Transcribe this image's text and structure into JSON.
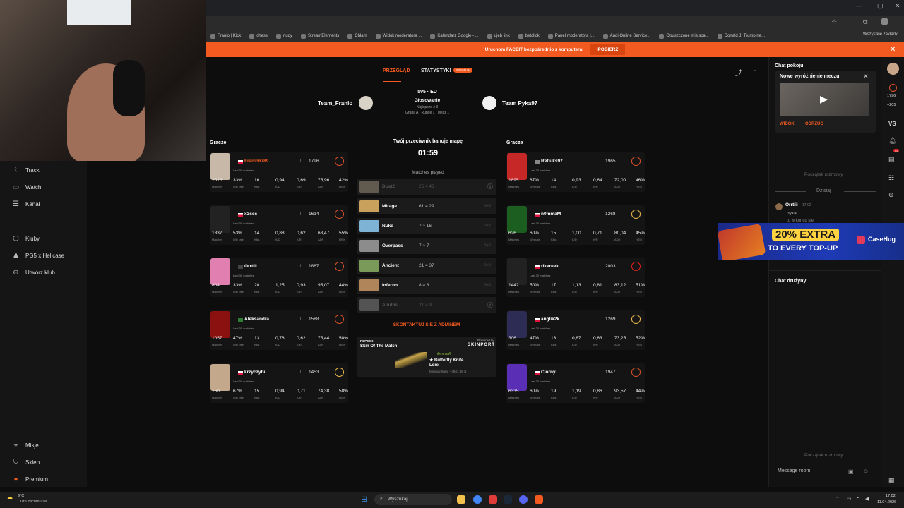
{
  "browser": {
    "bookmarks": [
      "Franio | Kick",
      "chess",
      "nudy",
      "StreamElements",
      "Chłam",
      "Widok moderatora ...",
      "Kalendarz Google - ...",
      "ujeb link",
      "betclick",
      "Panel moderatora |...",
      "Audi Online Service...",
      "Opuszczone miejsca...",
      "Donald J. Trump ne..."
    ],
    "all_bookmarks": "Wszystkie zakładki"
  },
  "sidebar": {
    "items": [
      {
        "label": "Track",
        "icon": "chart-icon"
      },
      {
        "label": "Watch",
        "icon": "video-icon"
      },
      {
        "label": "Kanał",
        "icon": "list-icon"
      },
      {
        "label": "Kluby",
        "icon": "shield-icon"
      },
      {
        "label": "PG5 x Hellcase",
        "icon": "club-icon"
      },
      {
        "label": "Utwórz klub",
        "icon": "plus-icon"
      },
      {
        "label": "Misje",
        "icon": "mission-icon"
      },
      {
        "label": "Sklep",
        "icon": "cart-icon"
      },
      {
        "label": "Premium",
        "icon": "premium-icon"
      }
    ]
  },
  "banner": {
    "text": "Uruchom FACEIT bezpośrednio z komputera!",
    "button": "POBIERZ",
    "close": "✕"
  },
  "match": {
    "tabs": {
      "overview": "PRZEGLĄD",
      "stats": "STATYSTYKI",
      "stats_badge": "PREMIUM"
    },
    "mode": "5v5 · EU",
    "status": "Głosowanie",
    "best_of": "Najlepsze z 3",
    "group": "Grupa A · Runde 1 · Mecz 1",
    "team1": "Team_Franio",
    "team2": "Team Pyka97",
    "players_label": "Gracze",
    "veto_title": "Twój przeciwnik banuje mapę",
    "timer": "01:59",
    "matches_played": "Matches played",
    "contact_admin": "SKONTAKTUJ SIĘ Z ADMINEM",
    "stat_labels": [
      "Matches",
      "Win rate",
      "Kills",
      "K/D",
      "K/R",
      "ADR",
      "HS%"
    ],
    "last30": "Last 30 matches"
  },
  "team1_players": [
    {
      "name": "Franio6789",
      "elo": "1796",
      "stats": [
        "2015",
        "33%",
        "16",
        "0,94",
        "0,69",
        "75,96",
        "42%"
      ],
      "name_color": "#f25a1f"
    },
    {
      "name": "x3scc",
      "elo": "1614",
      "stats": [
        "1837",
        "53%",
        "14",
        "0,88",
        "0,62",
        "68,47",
        "55%"
      ],
      "name_color": "#ffffff"
    },
    {
      "name": "Orrtiii",
      "elo": "1867",
      "stats": [
        "804",
        "33%",
        "20",
        "1,25",
        "0,93",
        "95,07",
        "44%"
      ],
      "name_color": "#ffffff"
    },
    {
      "name": "Aleksandra",
      "elo": "1588",
      "stats": [
        "1057",
        "47%",
        "13",
        "0,76",
        "0,62",
        "75,44",
        "58%"
      ],
      "name_color": "#ffffff"
    },
    {
      "name": "krzyczybu",
      "elo": "1453",
      "stats": [
        "160",
        "67%",
        "15",
        "0,94",
        "0,71",
        "74,38",
        "58%"
      ],
      "name_color": "#ffffff"
    }
  ],
  "team2_players": [
    {
      "name": "Refluks97",
      "elo": "1965",
      "stats": [
        "1895",
        "67%",
        "14",
        "0,93",
        "0,64",
        "72,00",
        "46%"
      ],
      "name_color": "#ffffff"
    },
    {
      "name": "n0mmaM",
      "elo": "1268",
      "stats": [
        "626",
        "60%",
        "15",
        "1,00",
        "0,71",
        "80,04",
        "45%"
      ],
      "name_color": "#ffffff"
    },
    {
      "name": "rikereek",
      "elo": "2003",
      "stats": [
        "1442",
        "50%",
        "17",
        "1,13",
        "0,81",
        "83,12",
        "51%"
      ],
      "name_color": "#ffffff"
    },
    {
      "name": "anglik2k",
      "elo": "1269",
      "stats": [
        "306",
        "47%",
        "13",
        "0,87",
        "0,63",
        "73,25",
        "52%"
      ],
      "name_color": "#ffffff"
    },
    {
      "name": "Ciorny",
      "elo": "1947",
      "stats": [
        "6335",
        "60%",
        "19",
        "1,19",
        "0,86",
        "93,57",
        "44%"
      ],
      "name_color": "#ffffff"
    }
  ],
  "maps": [
    {
      "name": "Dust2",
      "stat": "25 ≈ 43",
      "dim": true,
      "ban": ""
    },
    {
      "name": "Mirage",
      "stat": "61 ≈ 29",
      "dim": false,
      "ban": "BAN"
    },
    {
      "name": "Nuke",
      "stat": "7 ≈ 16",
      "dim": false,
      "ban": "BAN"
    },
    {
      "name": "Overpass",
      "stat": "7 ≈ 7",
      "dim": false,
      "ban": "BAN"
    },
    {
      "name": "Ancient",
      "stat": "21 ≈ 37",
      "dim": false,
      "ban": "BAN"
    },
    {
      "name": "Inferno",
      "stat": "8 ≈ 8",
      "dim": false,
      "ban": "BAN"
    },
    {
      "name": "Anubis",
      "stat": "21 ≈ 9",
      "dim": true,
      "ban": ""
    }
  ],
  "skin": {
    "label": "REPEEK",
    "title": "Skin Of The Match",
    "powered": "Powered by",
    "brand": "SKINPORT",
    "player": "n0mmaM",
    "item": "★ Butterfly Knife",
    "finish": "Lore",
    "wear": "Minimal Wear - 4947,88 zł"
  },
  "chat": {
    "room_title": "Chat pokoju",
    "popup_title": "Nowe wyróżnienie meczu",
    "popup_view": "WIDOK",
    "popup_reject": "ODRZUĆ",
    "start": "Początek rozmowy",
    "today": "Dzisiaj",
    "msg_user": "Orrtiii",
    "msg_time": "17:02",
    "msg_text": "pyka",
    "msg_text2": "to w koncu sie",
    "placeholder": "Message room",
    "team_chat": "Chat drużyny"
  },
  "promo": {
    "line1": "20% EXTRA",
    "line2": "TO EVERY TOP-UP",
    "brand": "CaseHug"
  },
  "rightbar": {
    "elo": "1796",
    "diff": "+205",
    "vs": "VS",
    "notif": "52"
  },
  "taskbar": {
    "weather": "9°C",
    "weather_desc": "Duże zachmurze...",
    "search": "Wyszukaj",
    "time": "17:02",
    "date": "11.04.2026"
  }
}
